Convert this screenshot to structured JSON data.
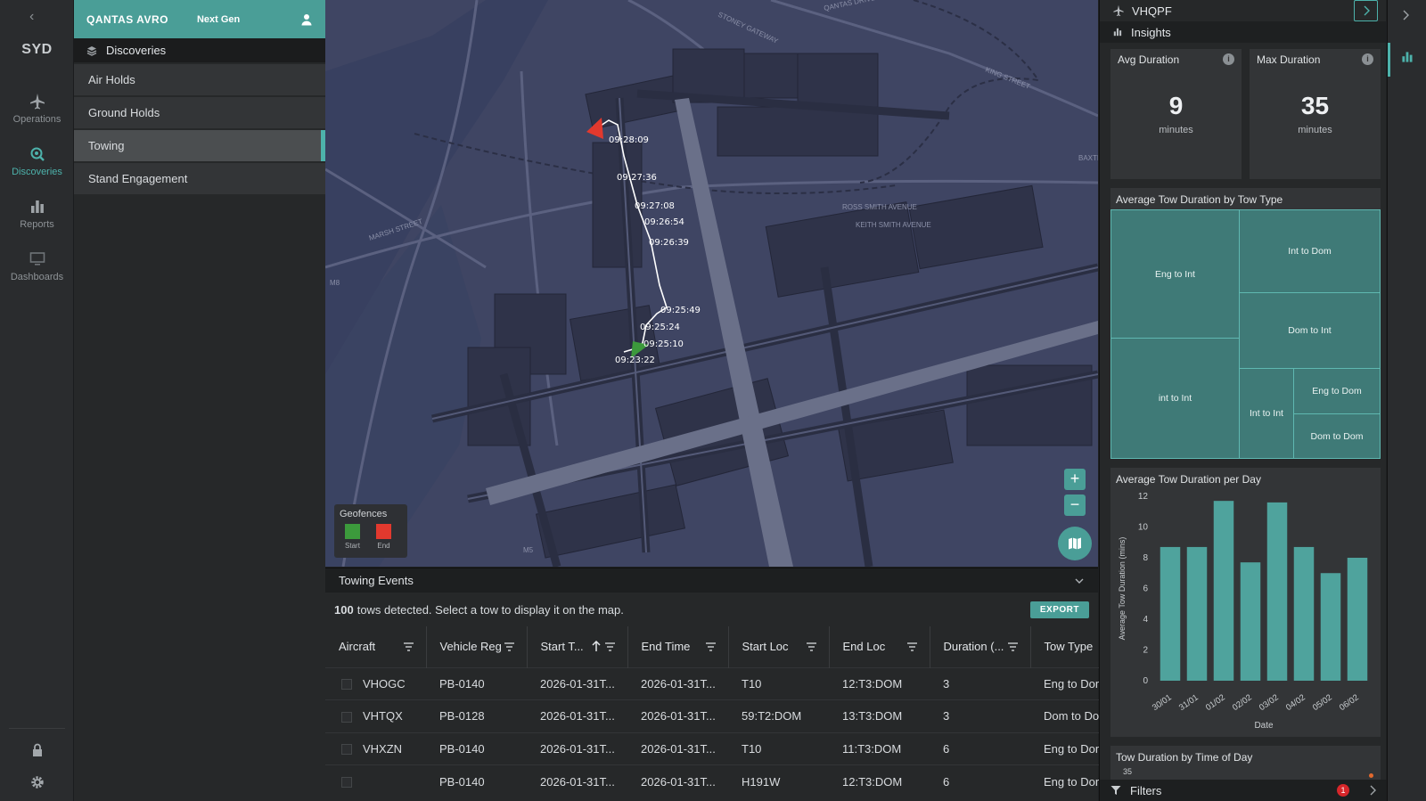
{
  "rail": {
    "airport": "SYD",
    "nav": [
      {
        "label": "Operations",
        "icon": "plane-icon"
      },
      {
        "label": "Discoveries",
        "icon": "search-icon",
        "active": true
      },
      {
        "label": "Reports",
        "icon": "bar-chart-icon"
      },
      {
        "label": "Dashboards",
        "icon": "monitor-icon"
      }
    ]
  },
  "brand": {
    "name": "QANTAS AVRO",
    "subtitle": "Next Gen"
  },
  "sidebar": {
    "section": "Discoveries",
    "items": [
      {
        "label": "Air Holds"
      },
      {
        "label": "Ground Holds"
      },
      {
        "label": "Towing",
        "active": true
      },
      {
        "label": "Stand Engagement"
      }
    ]
  },
  "map": {
    "timestamps": [
      "09:28:09",
      "09:27:36",
      "09:27:08",
      "09:26:54",
      "09:26:39",
      "09:25:49",
      "09:25:24",
      "09:25:10",
      "09:23:22"
    ],
    "geofences": {
      "title": "Geofences",
      "start_label": "Start",
      "end_label": "End",
      "start_color": "#3c9a3c",
      "end_color": "#e2392e"
    }
  },
  "events": {
    "title": "Towing Events",
    "count": "100",
    "summary_text": "tows detected. Select a tow to display it on the map.",
    "export_label": "EXPORT",
    "columns": [
      "Aircraft",
      "Vehicle Reg",
      "Start T...",
      "End Time",
      "Start Loc",
      "End Loc",
      "Duration (...",
      "Tow Type"
    ],
    "rows": [
      [
        "VHOGC",
        "PB-0140",
        "2026-01-31T...",
        "2026-01-31T...",
        "T10",
        "12:T3:DOM",
        "3",
        "Eng to Dom"
      ],
      [
        "VHTQX",
        "PB-0128",
        "2026-01-31T...",
        "2026-01-31T...",
        "59:T2:DOM",
        "13:T3:DOM",
        "3",
        "Dom to Dom"
      ],
      [
        "VHXZN",
        "PB-0140",
        "2026-01-31T...",
        "2026-01-31T...",
        "T10",
        "11:T3:DOM",
        "6",
        "Eng to Dom"
      ],
      [
        "",
        "PB-0140",
        "2026-01-31T...",
        "2026-01-31T...",
        "H191W",
        "12:T3:DOM",
        "6",
        "Eng to Dom"
      ]
    ]
  },
  "insights": {
    "aircraft": "VHQPF",
    "title": "Insights",
    "kpis": [
      {
        "label": "Avg Duration",
        "value": "9",
        "unit": "minutes"
      },
      {
        "label": "Max Duration",
        "value": "35",
        "unit": "minutes"
      }
    ],
    "treemap_title": "Average Tow Duration by Tow Type",
    "treemap": [
      "Eng to Int",
      "Int to Dom",
      "Dom to Int",
      "int to Int",
      "Int to Int",
      "Eng to Dom",
      "Dom to Dom"
    ],
    "day_chart_title": "Average Tow Duration per Day",
    "time_chart_title": "Tow Duration by Time of Day",
    "time_chart_first_tick": "35",
    "filters_label": "Filters",
    "filters_count": "1"
  },
  "chart_data": {
    "type": "bar",
    "title": "Average Tow Duration per Day",
    "xlabel": "Date",
    "ylabel": "Average Tow Duration (mins)",
    "categories": [
      "30/01",
      "31/01",
      "01/02",
      "02/02",
      "03/02",
      "04/02",
      "05/02",
      "06/02"
    ],
    "values": [
      8.7,
      8.7,
      11.7,
      7.7,
      11.6,
      8.7,
      7.0,
      8.0
    ],
    "ylim": [
      0,
      12
    ],
    "yticks": [
      0,
      2,
      4,
      6,
      8,
      10,
      12
    ],
    "color": "#4fa39d",
    "grid": false
  }
}
